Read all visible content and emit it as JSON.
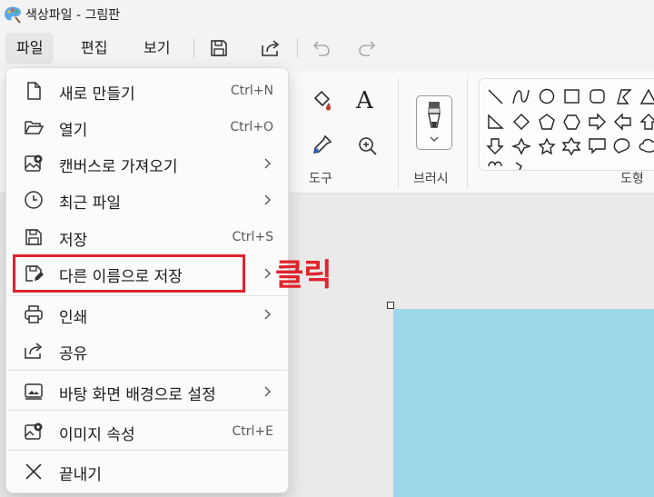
{
  "window": {
    "title": "색상파일 - 그림판",
    "app_icon": "paint-palette-icon"
  },
  "menubar": {
    "items": [
      {
        "label": "파일",
        "active": true
      },
      {
        "label": "편집",
        "active": false
      },
      {
        "label": "보기",
        "active": false
      }
    ],
    "toolbar_icons": [
      "save-icon",
      "share-icon",
      "undo-icon",
      "redo-icon"
    ]
  },
  "ribbon": {
    "groups": {
      "tools_label": "도구",
      "brushes_label": "브러시",
      "shapes_label": "도형"
    },
    "text_tool_glyph": "A"
  },
  "file_menu": {
    "items": [
      {
        "label": "새로 만들기",
        "icon": "new-file-icon",
        "shortcut": "Ctrl+N",
        "submenu": false
      },
      {
        "label": "열기",
        "icon": "folder-open-icon",
        "shortcut": "Ctrl+O",
        "submenu": false
      },
      {
        "label": "캔버스로 가져오기",
        "icon": "import-image-icon",
        "shortcut": "",
        "submenu": true
      },
      {
        "label": "최근 파일",
        "icon": "clock-icon",
        "shortcut": "",
        "submenu": true
      },
      {
        "label": "저장",
        "icon": "save-icon",
        "shortcut": "Ctrl+S",
        "submenu": false
      },
      {
        "label": "다른 이름으로 저장",
        "icon": "save-as-icon",
        "shortcut": "",
        "submenu": true
      },
      {
        "label": "인쇄",
        "icon": "printer-icon",
        "shortcut": "",
        "submenu": true
      },
      {
        "label": "공유",
        "icon": "share-icon",
        "shortcut": "",
        "submenu": false
      },
      {
        "label": "바탕 화면 배경으로 설정",
        "icon": "desktop-background-icon",
        "shortcut": "",
        "submenu": true
      },
      {
        "label": "이미지 속성",
        "icon": "image-properties-icon",
        "shortcut": "Ctrl+E",
        "submenu": false
      },
      {
        "label": "끝내기",
        "icon": "close-icon",
        "shortcut": "",
        "submenu": false
      }
    ]
  },
  "annotation": {
    "text": "클릭",
    "color": "#e0232b"
  },
  "colors": {
    "canvas_fill": "#9ad8ea",
    "highlight": "#e0232b"
  }
}
